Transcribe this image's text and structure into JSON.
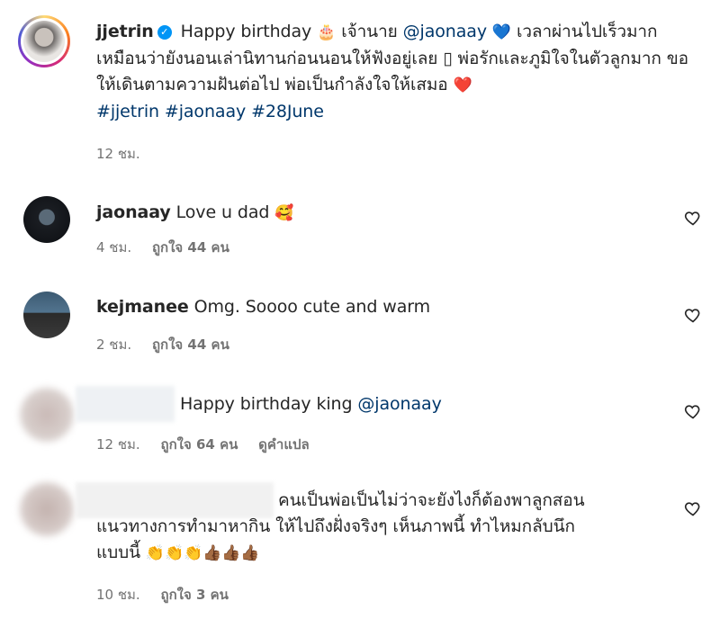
{
  "post": {
    "username": "jjetrin",
    "verified_mark": "✓",
    "caption_start": "Happy birthday",
    "cake_emoji": "🎂",
    "caption_mid": "เจ้านาย",
    "mention": "@jaonaay",
    "blue_heart": "💙",
    "caption_rest": "เวลาผ่านไปเร็วมาก เหมือนว่ายังนอนเล่านิทานก่อนนอนให้ฟังอยู่เลย ▯ พ่อรักและภูมิใจในตัวลูกมาก ขอให้เดินตามความฝันต่อไป พ่อเป็นกำลังใจให้เสมอ",
    "red_heart": "❤️",
    "hashtags": "#jjetrin #jaonaay #28June",
    "time": "12 ชม."
  },
  "comments": [
    {
      "username": "jaonaay",
      "text": "Love u dad",
      "emoji": "🥰",
      "time": "4 ชม.",
      "likes": "ถูกใจ 44 คน"
    },
    {
      "username": "kejmanee",
      "text": "Omg. Soooo cute and warm",
      "time": "2 ชม.",
      "likes": "ถูกใจ 44 คน"
    },
    {
      "text": "Happy birthday king",
      "mention": "@jaonaay",
      "time": "12 ชม.",
      "likes": "ถูกใจ 64 คน",
      "translate": "ดูคำแปล"
    },
    {
      "text_line1": "คนเป็นพ่อเป็นไม่ว่าจะยังไงก็ต้องพาลูกสอน",
      "text_line2": "แนวทางการทำมาหากิน ให้ไปถึงฝั่งจริงๆ เห็นภาพนี้ ทำไหมกลับนึก",
      "text_line3": "แบบนี้",
      "emojis": "👏👏👏👍🏾👍🏾👍🏾",
      "time": "10 ชม.",
      "likes": "ถูกใจ 3 คน"
    }
  ],
  "icons": {
    "post_avatar": "avatar",
    "like": "heart-outline-icon"
  }
}
